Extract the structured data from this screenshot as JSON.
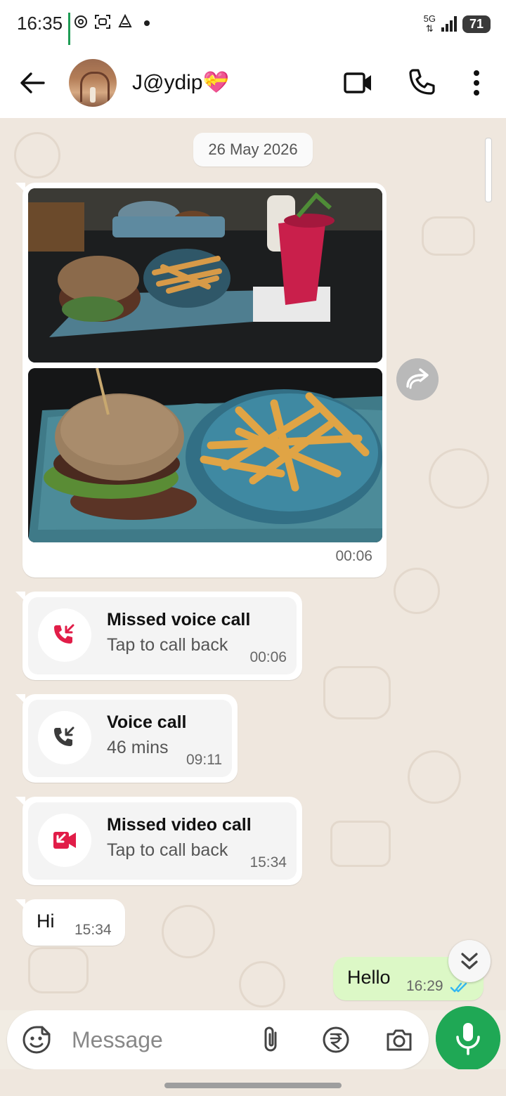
{
  "status_bar": {
    "time": "16:35",
    "network": "5G",
    "battery": "71",
    "icons": [
      "nfc-icon",
      "scan-icon",
      "network-icon",
      "dot-icon",
      "signal-icon",
      "battery-icon"
    ]
  },
  "header": {
    "contact_name": "J@ydip",
    "name_emoji": "💝",
    "icons": [
      "back-arrow-icon",
      "video-call-icon",
      "voice-call-icon",
      "more-options-icon"
    ]
  },
  "chat": {
    "date_chip": "26 May 2026",
    "photo_message": {
      "time": "00:06",
      "photo_count": 2
    },
    "calls": [
      {
        "title": "Missed voice call",
        "subtitle": "Tap to call back",
        "time": "00:06",
        "icon": "missed-voice-call-icon",
        "color": "#e11d48"
      },
      {
        "title": "Voice call",
        "subtitle": "46 mins",
        "time": "09:11",
        "icon": "incoming-voice-call-icon",
        "color": "#3b3b3b"
      },
      {
        "title": "Missed video call",
        "subtitle": "Tap to call back",
        "time": "15:34",
        "icon": "missed-video-call-icon",
        "color": "#e11d48"
      }
    ],
    "incoming_text": {
      "text": "Hi",
      "time": "15:34"
    },
    "outgoing_text": {
      "text": "Hello",
      "time": "16:29",
      "status": "read"
    }
  },
  "composer": {
    "placeholder": "Message",
    "value": "",
    "icons": [
      "sticker-icon",
      "attach-icon",
      "rupee-payment-icon",
      "camera-icon",
      "mic-icon"
    ]
  },
  "colors": {
    "accent_green": "#1fa855",
    "outgoing_bubble": "#dcf8c6",
    "missed_red": "#e11d48",
    "read_ticks": "#34b7f1",
    "chat_background": "#efe7de"
  }
}
